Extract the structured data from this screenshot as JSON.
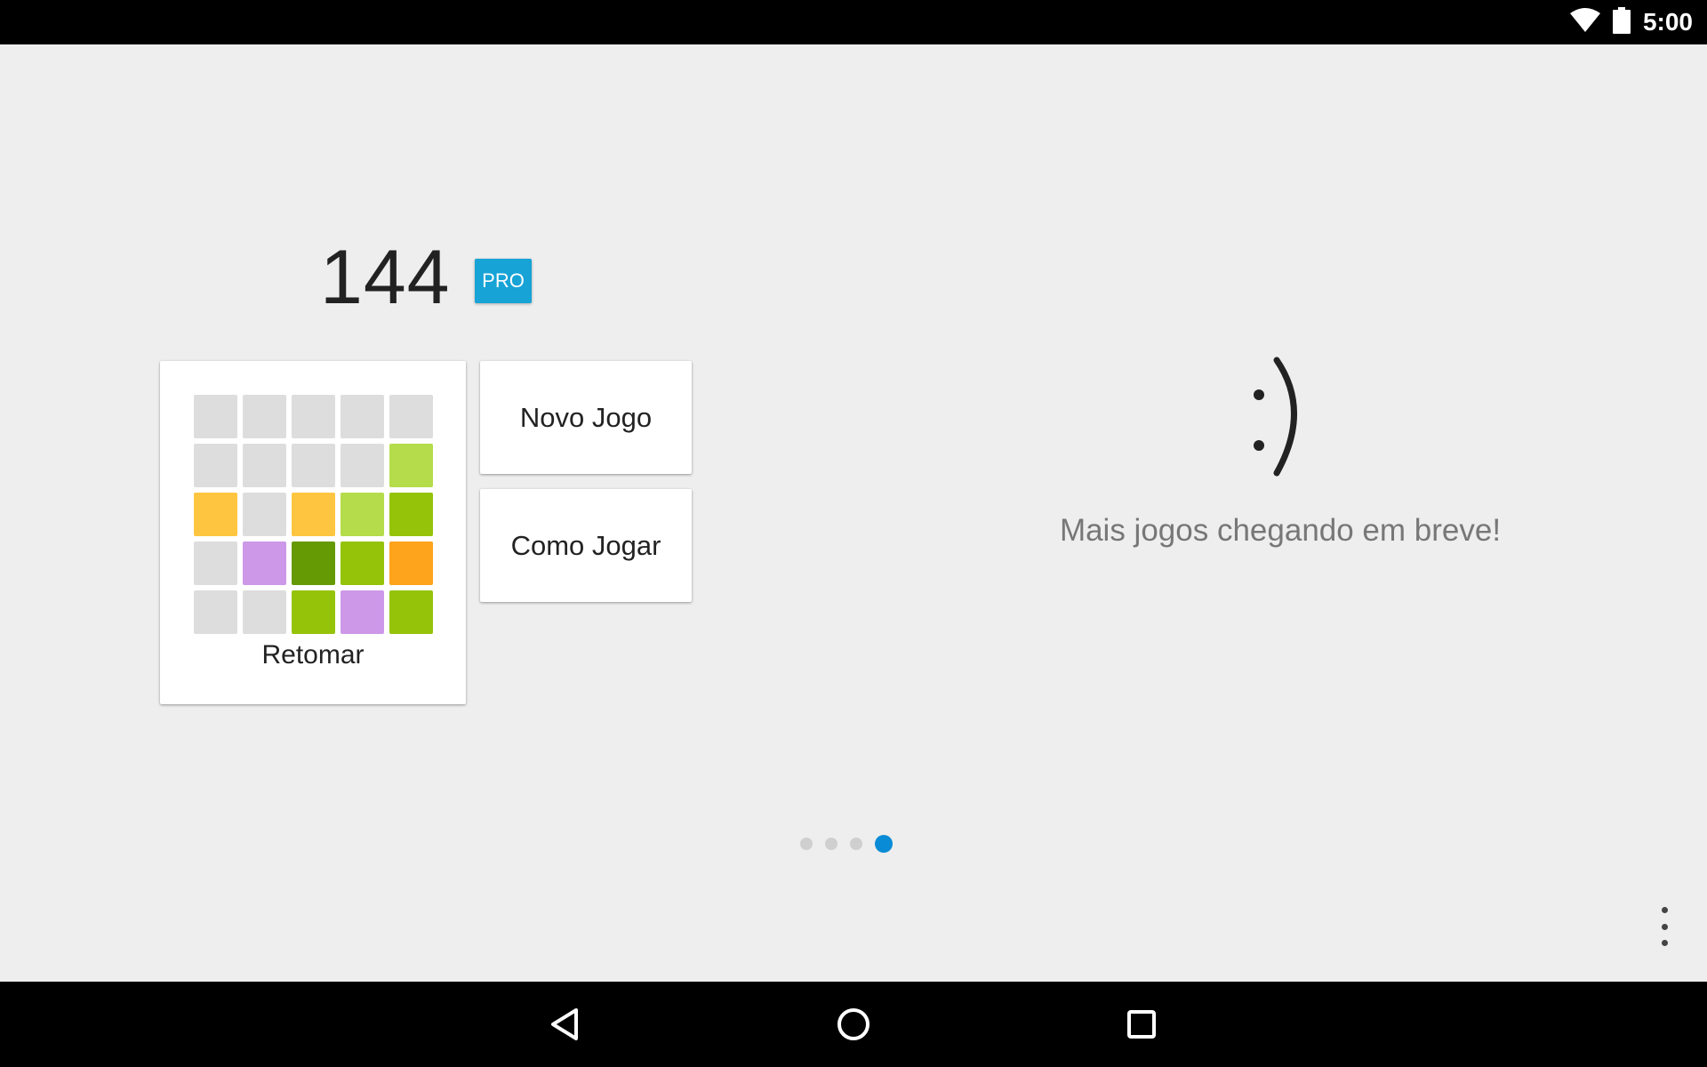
{
  "status_bar": {
    "time": "5:00",
    "icons": [
      "wifi-icon",
      "battery-icon"
    ]
  },
  "game": {
    "score": "144",
    "pro_badge": "PRO",
    "pro_color": "#17a3d6",
    "resume_label": "Retomar",
    "new_game_label": "Novo Jogo",
    "how_to_play_label": "Como Jogar",
    "preview_grid": [
      [
        "#dddddd",
        "#dddddd",
        "#dddddd",
        "#dddddd",
        "#dddddd"
      ],
      [
        "#dddddd",
        "#dddddd",
        "#dddddd",
        "#dddddd",
        "#b5dc4a"
      ],
      [
        "#fec640",
        "#dddddd",
        "#fec640",
        "#b5dc4a",
        "#95c30a"
      ],
      [
        "#dddddd",
        "#cd98e8",
        "#659a05",
        "#95c30a",
        "#fea31c"
      ],
      [
        "#dddddd",
        "#dddddd",
        "#95c30a",
        "#cd98e8",
        "#95c30a"
      ]
    ]
  },
  "coming_soon": {
    "smiley": ":)",
    "text": "Mais jogos chegando em breve!"
  },
  "pager": {
    "page_count": 4,
    "active_index": 3,
    "active_color": "#0a8bd6"
  },
  "nav_bar": {
    "buttons": [
      "back-icon",
      "home-icon",
      "recents-icon"
    ]
  }
}
